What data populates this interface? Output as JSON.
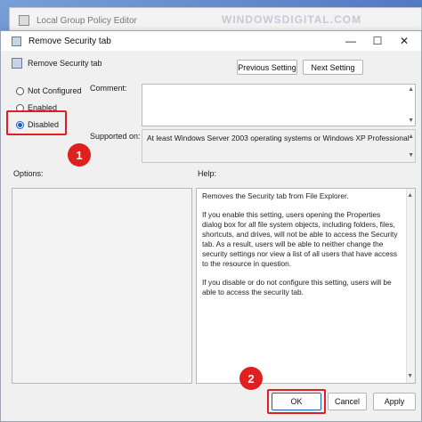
{
  "background_window": {
    "title": "Local Group Policy Editor",
    "watermark": "WINDOWSDIGITAL.COM"
  },
  "dialog": {
    "title": "Remove Security tab",
    "header_label": "Remove Security tab",
    "minimize_glyph": "—",
    "maximize_glyph": "☐",
    "close_glyph": "✕",
    "previous_setting": "Previous Setting",
    "next_setting": "Next Setting",
    "radios": {
      "not_configured": "Not Configured",
      "enabled": "Enabled",
      "disabled": "Disabled",
      "selected": "disabled"
    },
    "comment_label": "Comment:",
    "comment_value": "",
    "supported_on_label": "Supported on:",
    "supported_on_value": "At least Windows Server 2003 operating systems or Windows XP Professional",
    "options_label": "Options:",
    "help_label": "Help:",
    "help_text": [
      "Removes the Security tab from File Explorer.",
      "If you enable this setting, users opening the Properties dialog box for all file system objects, including folders, files, shortcuts, and drives, will not be able to access the Security tab. As a result, users will be able to neither change the security settings nor view a list of all users that have access to the resource in question.",
      "If you disable or do not configure this setting, users will be able to access the security tab."
    ],
    "ok": "OK",
    "cancel": "Cancel",
    "apply": "Apply"
  },
  "annotations": {
    "step1": "1",
    "step2": "2",
    "highlight_color": "#e02020"
  }
}
